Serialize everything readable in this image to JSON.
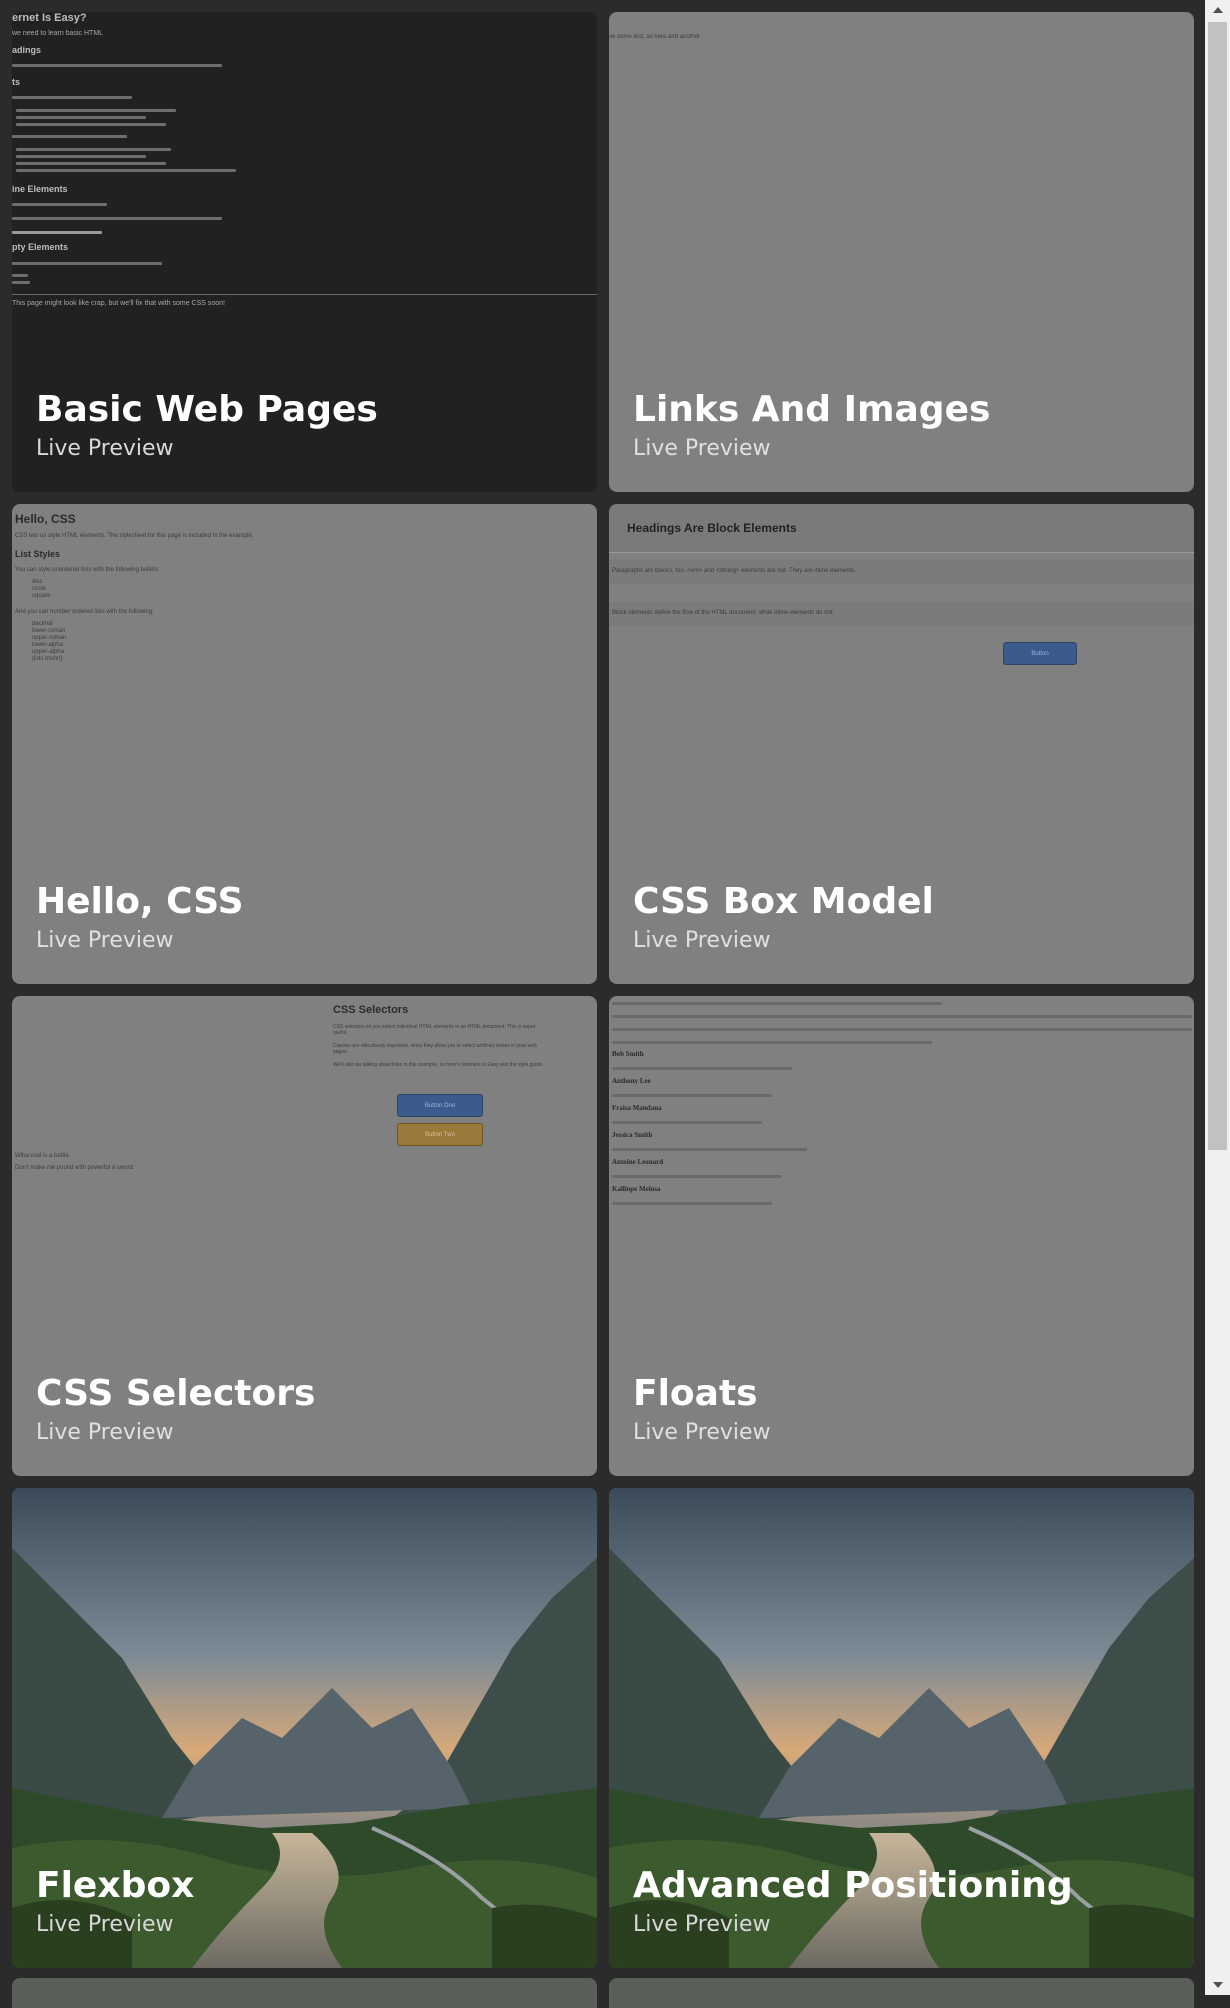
{
  "cards": [
    {
      "title": "Basic Web Pages",
      "subtitle": "Live Preview",
      "preview": {
        "heading": "ernet Is Easy?",
        "intro": "we need to learn basic HTML",
        "sections": [
          "adings",
          "ts",
          "ine Elements",
          "pty Elements"
        ],
        "footer": "This page might look like crap, but we'll fix that with some CSS soon!"
      }
    },
    {
      "title": "Links And Images",
      "subtitle": "Live Preview",
      "preview": {
        "line": "ve some text, so here and another"
      }
    },
    {
      "title": "Hello, CSS",
      "subtitle": "Live Preview",
      "preview": {
        "heading": "Hello, CSS",
        "intro": "CSS lets us style HTML elements. The stylesheet for this page is included in the example.",
        "section": "List Styles",
        "list_intro": "You can style unordered lists with the following bullets:",
        "bullets": [
          "disc",
          "circle",
          "square"
        ],
        "ordered_intro": "And you can number ordered lists with the following:",
        "ordered": [
          "decimal",
          "lower-roman",
          "upper-roman",
          "lower-alpha",
          "upper-alpha",
          "(lots more!)"
        ]
      }
    },
    {
      "title": "CSS Box Model",
      "subtitle": "Live Preview",
      "preview": {
        "heading": "Headings Are Block Elements",
        "para1": "Paragraphs are blocks, too. <em> and <strong> elements are not. They are inline elements.",
        "para2": "Block elements define the flow of the HTML document, while inline elements do not.",
        "button": "Button"
      }
    },
    {
      "title": "CSS Selectors",
      "subtitle": "Live Preview",
      "preview": {
        "heading": "CSS Selectors",
        "para1": "CSS selectors let you select individual HTML elements in an HTML document. This is super useful.",
        "para2": "Classes are ridiculously important, since they allow you to select arbitrary boxes in your web pages.",
        "para3": "We'll also be talking about links in this example, so here's Internets Is Easy and the style guide.",
        "button_one": "Button One",
        "button_two": "Button Two",
        "side1": "Wiha cool is a battle.",
        "side2": "Don't make me pound with powerful a sword."
      }
    },
    {
      "title": "Floats",
      "subtitle": "Live Preview",
      "preview": {
        "names": [
          "Bob Smith",
          "Anthony Lee",
          "Fraisa Mandana",
          "Jessica Smith",
          "Antoine Leonard",
          "Kalliope Melosa"
        ]
      }
    },
    {
      "title": "Flexbox",
      "subtitle": "Live Preview",
      "preview": {
        "image": "mountain-valley-photo"
      }
    },
    {
      "title": "Advanced Positioning",
      "subtitle": "Live Preview",
      "preview": {
        "image": "mountain-valley-photo"
      }
    }
  ],
  "colors": {
    "page_bg": "#2b2b2b",
    "card_light": "#808080",
    "card_dark": "#212121",
    "title": "#ffffff"
  }
}
